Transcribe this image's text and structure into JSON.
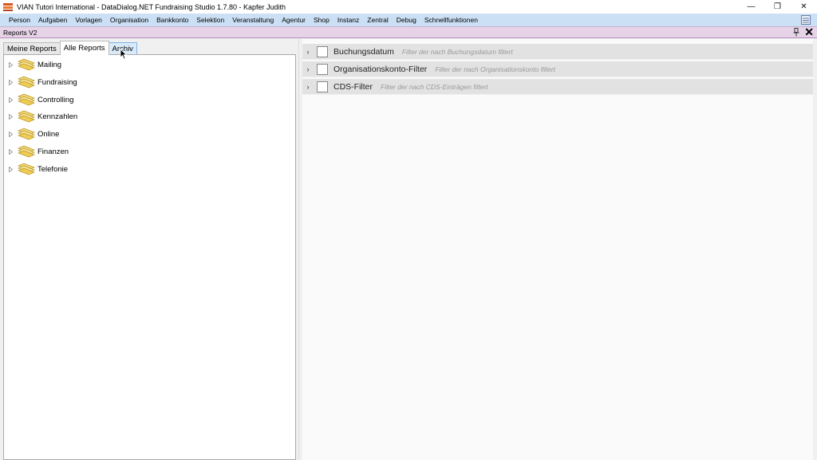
{
  "window": {
    "title": "VIAN Tutori International - DataDialog.NET Fundraising Studio 1.7.80 - Kapfer Judith",
    "minimize": "—",
    "maximize": "❐",
    "close": "✕"
  },
  "menu": [
    {
      "label": "Person"
    },
    {
      "label": "Aufgaben"
    },
    {
      "label": "Vorlagen"
    },
    {
      "label": "Organisation"
    },
    {
      "label": "Bankkonto"
    },
    {
      "label": "Selektion"
    },
    {
      "label": "Veranstaltung"
    },
    {
      "label": "Agentur"
    },
    {
      "label": "Shop"
    },
    {
      "label": "Instanz"
    },
    {
      "label": "Zentral"
    },
    {
      "label": "Debug"
    },
    {
      "label": "Schnellfunktionen"
    }
  ],
  "document": {
    "title": "Reports V2",
    "pin": "📌",
    "close": "✕"
  },
  "tabs": [
    {
      "label": "Meine Reports",
      "state": "normal"
    },
    {
      "label": "Alle Reports",
      "state": "active"
    },
    {
      "label": "Archiv",
      "state": "hover"
    }
  ],
  "tree": [
    {
      "label": "Mailing"
    },
    {
      "label": "Fundraising"
    },
    {
      "label": "Controlling"
    },
    {
      "label": "Kennzahlen"
    },
    {
      "label": "Online"
    },
    {
      "label": "Finanzen"
    },
    {
      "label": "Telefonie"
    }
  ],
  "filters": [
    {
      "name": "Buchungsdatum",
      "description": "Filter der nach Buchungsdatum filtert",
      "checked": false
    },
    {
      "name": "Organisationskonto-Filter",
      "description": "Filter der nach Organisationskonto filtert",
      "checked": false
    },
    {
      "name": "CDS-Filter",
      "description": "Filter der nach CDS-Einträgen filtert",
      "checked": false
    }
  ],
  "colors": {
    "menubar": "#cce0f5",
    "docbar": "#e6d3e8",
    "filter_row": "#e2e2e2"
  }
}
